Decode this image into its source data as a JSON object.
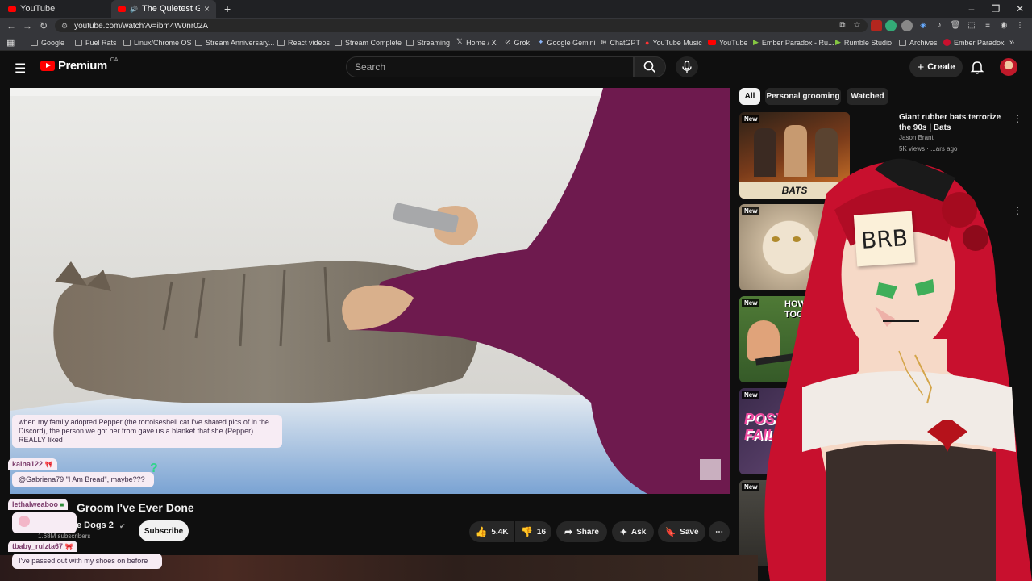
{
  "browser": {
    "tabs": [
      {
        "label": "YouTube",
        "active": false
      },
      {
        "label": "The Quietest Groom I'v",
        "active": true
      }
    ],
    "new_tab_symbol": "+",
    "url": "youtube.com/watch?v=ibm4W0nr02A",
    "bookmarks": [
      {
        "label": "Google",
        "icon": "google-icon"
      },
      {
        "label": "Fuel Rats",
        "icon": "folder-icon"
      },
      {
        "label": "Linux/Chrome OS",
        "icon": "folder-icon"
      },
      {
        "label": "Stream Anniversary...",
        "icon": "folder-icon"
      },
      {
        "label": "React videos",
        "icon": "folder-icon"
      },
      {
        "label": "Stream Complete",
        "icon": "folder-icon"
      },
      {
        "label": "Streaming",
        "icon": "folder-icon"
      },
      {
        "label": "Home / X",
        "icon": "x-icon"
      },
      {
        "label": "Grok",
        "icon": "grok-icon"
      },
      {
        "label": "Google Gemini",
        "icon": "gemini-icon"
      },
      {
        "label": "ChatGPT",
        "icon": "chatgpt-icon"
      },
      {
        "label": "YouTube Music",
        "icon": "youtube-music-icon"
      },
      {
        "label": "YouTube",
        "icon": "youtube-icon"
      },
      {
        "label": "Ember Paradox - Ru...",
        "icon": "rumble-icon"
      },
      {
        "label": "Rumble Studio",
        "icon": "rumble-icon"
      },
      {
        "label": "Archives",
        "icon": "folder-icon"
      },
      {
        "label": "Ember Paradox",
        "icon": "avatar-icon"
      }
    ]
  },
  "youtube": {
    "logo_text": "Premium",
    "logo_region": "CA",
    "search_placeholder": "Search",
    "create_label": "Create",
    "video": {
      "title": "Groom I've Ever Done",
      "channel": "e Dogs 2",
      "subscribers": "1.68M subscribers",
      "subscribe_label": "Subscribe",
      "likes": "5.4K",
      "dislikes": "16",
      "share_label": "Share",
      "ask_label": "Ask",
      "save_label": "Save"
    },
    "chips": [
      "All",
      "Personal grooming",
      "Watched"
    ],
    "recommendations": [
      {
        "badge": "New",
        "title": "Giant rubber bats terrorize the 90s | Bats",
        "channel": "Jason Brant",
        "meta": "5K views · ...ars ago",
        "thumb_text": "BATS"
      },
      {
        "badge": "New",
        "title": "",
        "channel": "",
        "meta": "",
        "thumb_text": ""
      },
      {
        "badge": "New",
        "title": "",
        "channel": "",
        "meta": "",
        "thumb_text": "HOW BENT IS TOO BENT"
      },
      {
        "badge": "New",
        "title": "",
        "channel": "",
        "meta": "",
        "thumb_text": "POSTER FAIL"
      },
      {
        "badge": "New",
        "title": "",
        "channel": "",
        "meta": "",
        "thumb_text": ""
      }
    ]
  },
  "overlay": {
    "brb_text": "BRB",
    "chat": [
      {
        "user": "",
        "message": "when my family adopted Pepper (the tortoiseshell cat I've shared pics of in the Discord), the person we got her from gave us a blanket that she (Pepper) REALLY liked"
      },
      {
        "user": "kaina122",
        "message": "@Gabriena79 \"I Am Bread\", maybe???"
      },
      {
        "user": "lethalweaboo",
        "message": ""
      },
      {
        "user": "tbaby_rulzta67",
        "message": "I've passed out with my shoes on before"
      }
    ]
  },
  "colors": {
    "youtube_red": "#ff0000",
    "page_bg": "#0f0f0f",
    "chat_bubble": "#f7ecf4",
    "vtuber_hair": "#c8102e",
    "sweater": "#6e1a4e"
  }
}
